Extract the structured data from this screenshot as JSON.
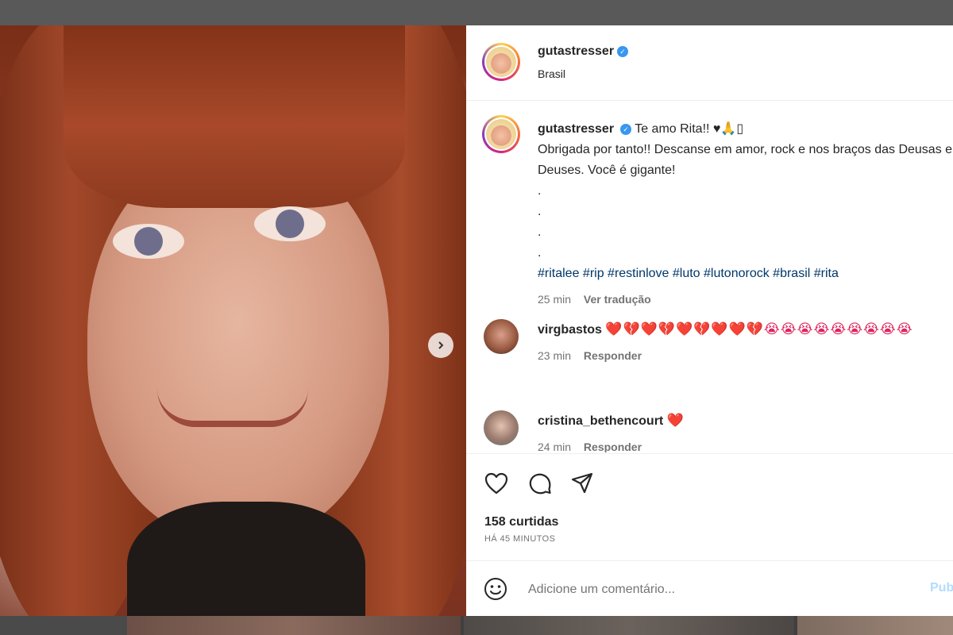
{
  "post": {
    "username": "gutastresser",
    "location": "Brasil",
    "caption_first": "Te amo Rita!! ♥🙏▯",
    "caption_body": "Obrigada por tanto!! Descanse em amor, rock e nos braços das Deusas e Deuses. Você é gigante!",
    "caption_dots": [
      ".",
      ".",
      ".",
      "."
    ],
    "hashtags": "#ritalee #rip #restinlove #luto #lutonorock #brasil #rita",
    "caption_time": "25 min",
    "translate_label": "Ver tradução"
  },
  "comments": [
    {
      "username": "virgbastos",
      "text": "❤️💔❤️💔❤️💔❤️❤️💔😭😭😭😭😭😭😭😭😭",
      "time": "23 min",
      "reply_label": "Responder"
    },
    {
      "username": "cristina_bethencourt",
      "text": "❤️",
      "time": "24 min",
      "reply_label": "Responder"
    }
  ],
  "stats": {
    "likes": "158 curtidas",
    "time_ago": "HÁ 45 MINUTOS"
  },
  "composer": {
    "placeholder": "Adicione um comentário...",
    "publish_label": "Publicar"
  },
  "colors": {
    "link": "#00376b",
    "verified": "#3897f0",
    "publish_disabled": "#b3dbff",
    "muted": "#737373"
  },
  "icons": [
    "chevron-right-icon",
    "verified-badge-icon",
    "heart-icon",
    "comment-icon",
    "share-icon",
    "smile-icon"
  ],
  "carousel": {
    "total_slides": 2,
    "active_slide": 1
  }
}
